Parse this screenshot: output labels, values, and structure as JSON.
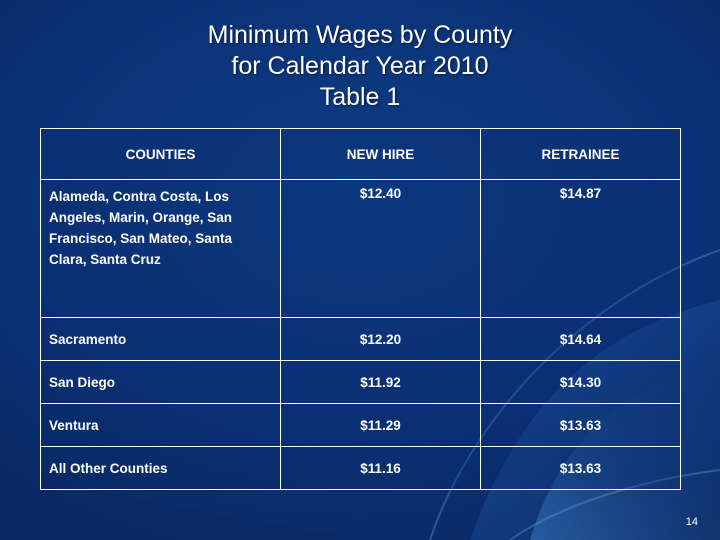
{
  "slide": {
    "title_lines": [
      "Minimum Wages by County",
      "for Calendar Year 2010",
      "Table 1"
    ],
    "page_number": "14",
    "background_color": "#0b3277",
    "text_color": "#ffffff"
  },
  "table": {
    "headers": [
      "COUNTIES",
      "NEW HIRE",
      "RETRAINEE"
    ],
    "rows": [
      {
        "counties": "Alameda, Contra Costa, Los Angeles, Marin, Orange, San Francisco, San Mateo, Santa Clara, Santa Cruz",
        "new_hire": "$12.40",
        "retrainee": "$14.87"
      },
      {
        "counties": "Sacramento",
        "new_hire": "$12.20",
        "retrainee": "$14.64"
      },
      {
        "counties": "San Diego",
        "new_hire": "$11.92",
        "retrainee": "$14.30"
      },
      {
        "counties": "Ventura",
        "new_hire": "$11.29",
        "retrainee": "$13.63"
      },
      {
        "counties": "All Other Counties",
        "new_hire": "$11.16",
        "retrainee": "$13.63"
      }
    ]
  }
}
